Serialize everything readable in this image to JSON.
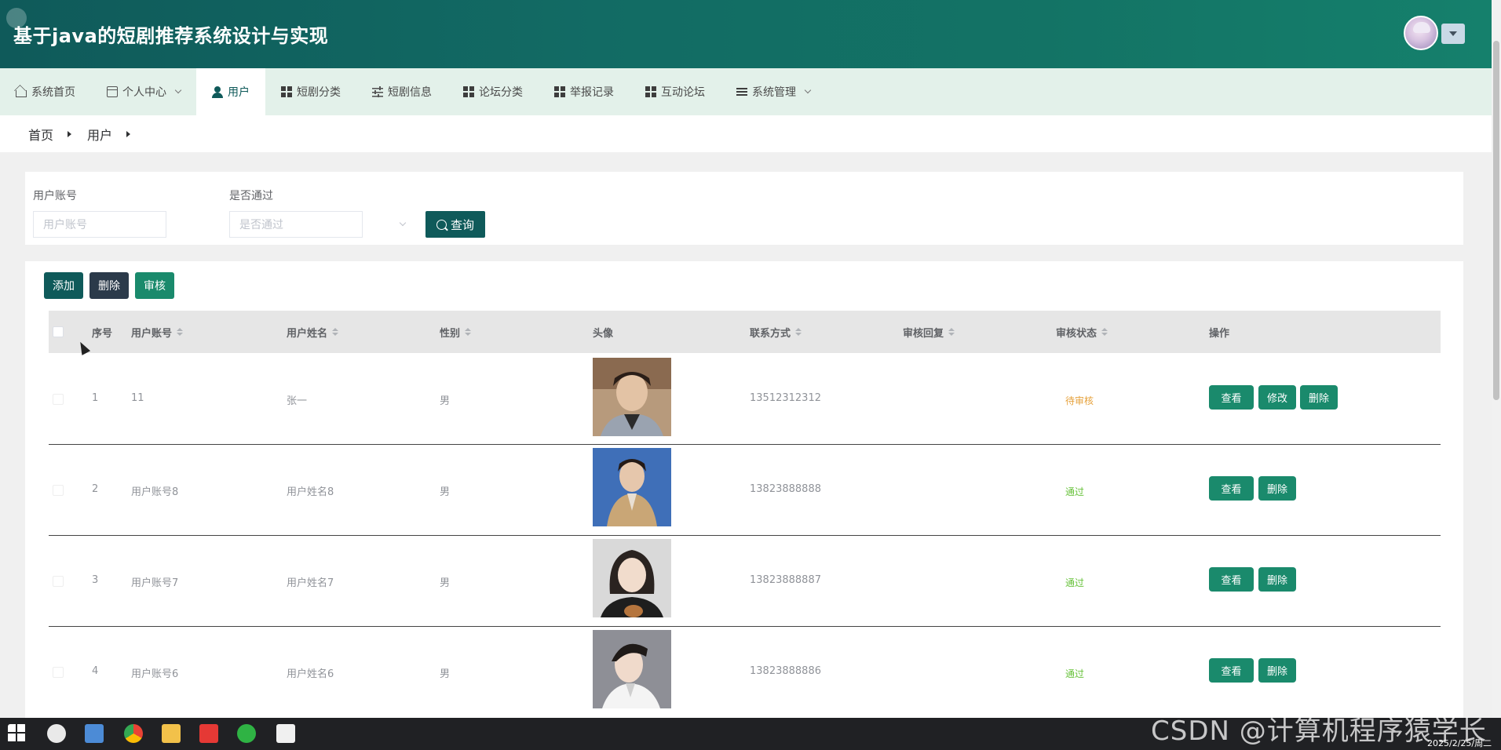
{
  "app": {
    "title": "基于java的短剧推荐系统设计与实现"
  },
  "nav": [
    {
      "label": "系统首页",
      "icon": "home-icon"
    },
    {
      "label": "个人中心",
      "icon": "card-icon",
      "dropdown": true
    },
    {
      "label": "用户",
      "icon": "user-icon",
      "active": true
    },
    {
      "label": "短剧分类",
      "icon": "grid-icon"
    },
    {
      "label": "短剧信息",
      "icon": "sliders-icon"
    },
    {
      "label": "论坛分类",
      "icon": "grid-icon"
    },
    {
      "label": "举报记录",
      "icon": "grid-icon"
    },
    {
      "label": "互动论坛",
      "icon": "grid-icon"
    },
    {
      "label": "系统管理",
      "icon": "list-icon",
      "dropdown": true
    }
  ],
  "breadcrumb": [
    "首页",
    "用户"
  ],
  "search": {
    "account_label": "用户账号",
    "account_placeholder": "用户账号",
    "passed_label": "是否通过",
    "passed_placeholder": "是否通过",
    "query_label": "查询"
  },
  "toolbar": {
    "add": "添加",
    "delete": "删除",
    "audit": "审核"
  },
  "table": {
    "columns": [
      "序号",
      "用户账号",
      "用户姓名",
      "性别",
      "头像",
      "联系方式",
      "审核回复",
      "审核状态",
      "操作"
    ],
    "rows": [
      {
        "idx": "1",
        "account": "11",
        "name": "张一",
        "gender": "男",
        "phone": "13512312312",
        "reply": "",
        "status": "待审核",
        "actions": [
          "查看",
          "修改",
          "删除"
        ]
      },
      {
        "idx": "2",
        "account": "用户账号8",
        "name": "用户姓名8",
        "gender": "男",
        "phone": "13823888888",
        "reply": "",
        "status": "通过",
        "actions": [
          "查看",
          "删除"
        ]
      },
      {
        "idx": "3",
        "account": "用户账号7",
        "name": "用户姓名7",
        "gender": "男",
        "phone": "13823888887",
        "reply": "",
        "status": "通过",
        "actions": [
          "查看",
          "删除"
        ]
      },
      {
        "idx": "4",
        "account": "用户账号6",
        "name": "用户姓名6",
        "gender": "男",
        "phone": "13823888886",
        "reply": "",
        "status": "通过",
        "actions": [
          "查看",
          "删除"
        ]
      }
    ]
  },
  "colors": {
    "primary": "#0f5a5a",
    "success": "#1a8a6c",
    "pending": "#e6a23c",
    "passed": "#67c23a",
    "nav_bg": "#e3f1ea"
  },
  "taskbar": {
    "date": "2025/2/25/周二"
  },
  "watermark": "CSDN @计算机程序猿学长"
}
